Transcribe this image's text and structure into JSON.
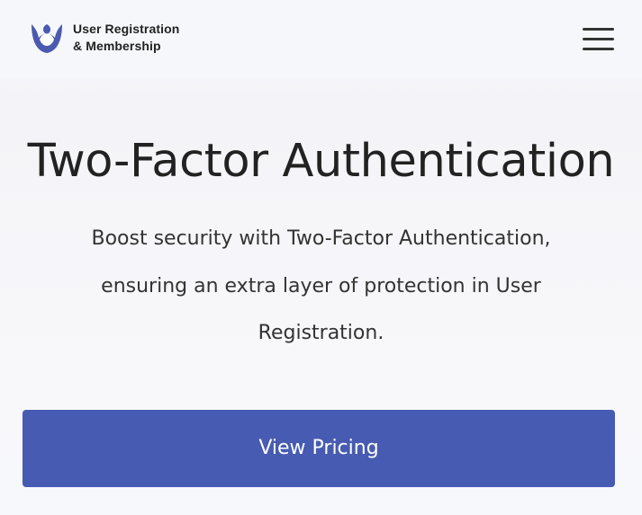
{
  "brand": {
    "logo_icon": "user-registration-logo-icon",
    "name_line1": "User Registration",
    "name_line2": "& Membership",
    "accent_color": "#475bb2"
  },
  "header": {
    "menu_icon": "hamburger-menu-icon"
  },
  "hero": {
    "title": "Two-Factor Authentication",
    "description": "Boost security with Two-Factor Authentication, ensuring an extra layer of protection in User Registration.",
    "cta_label": "View Pricing"
  }
}
